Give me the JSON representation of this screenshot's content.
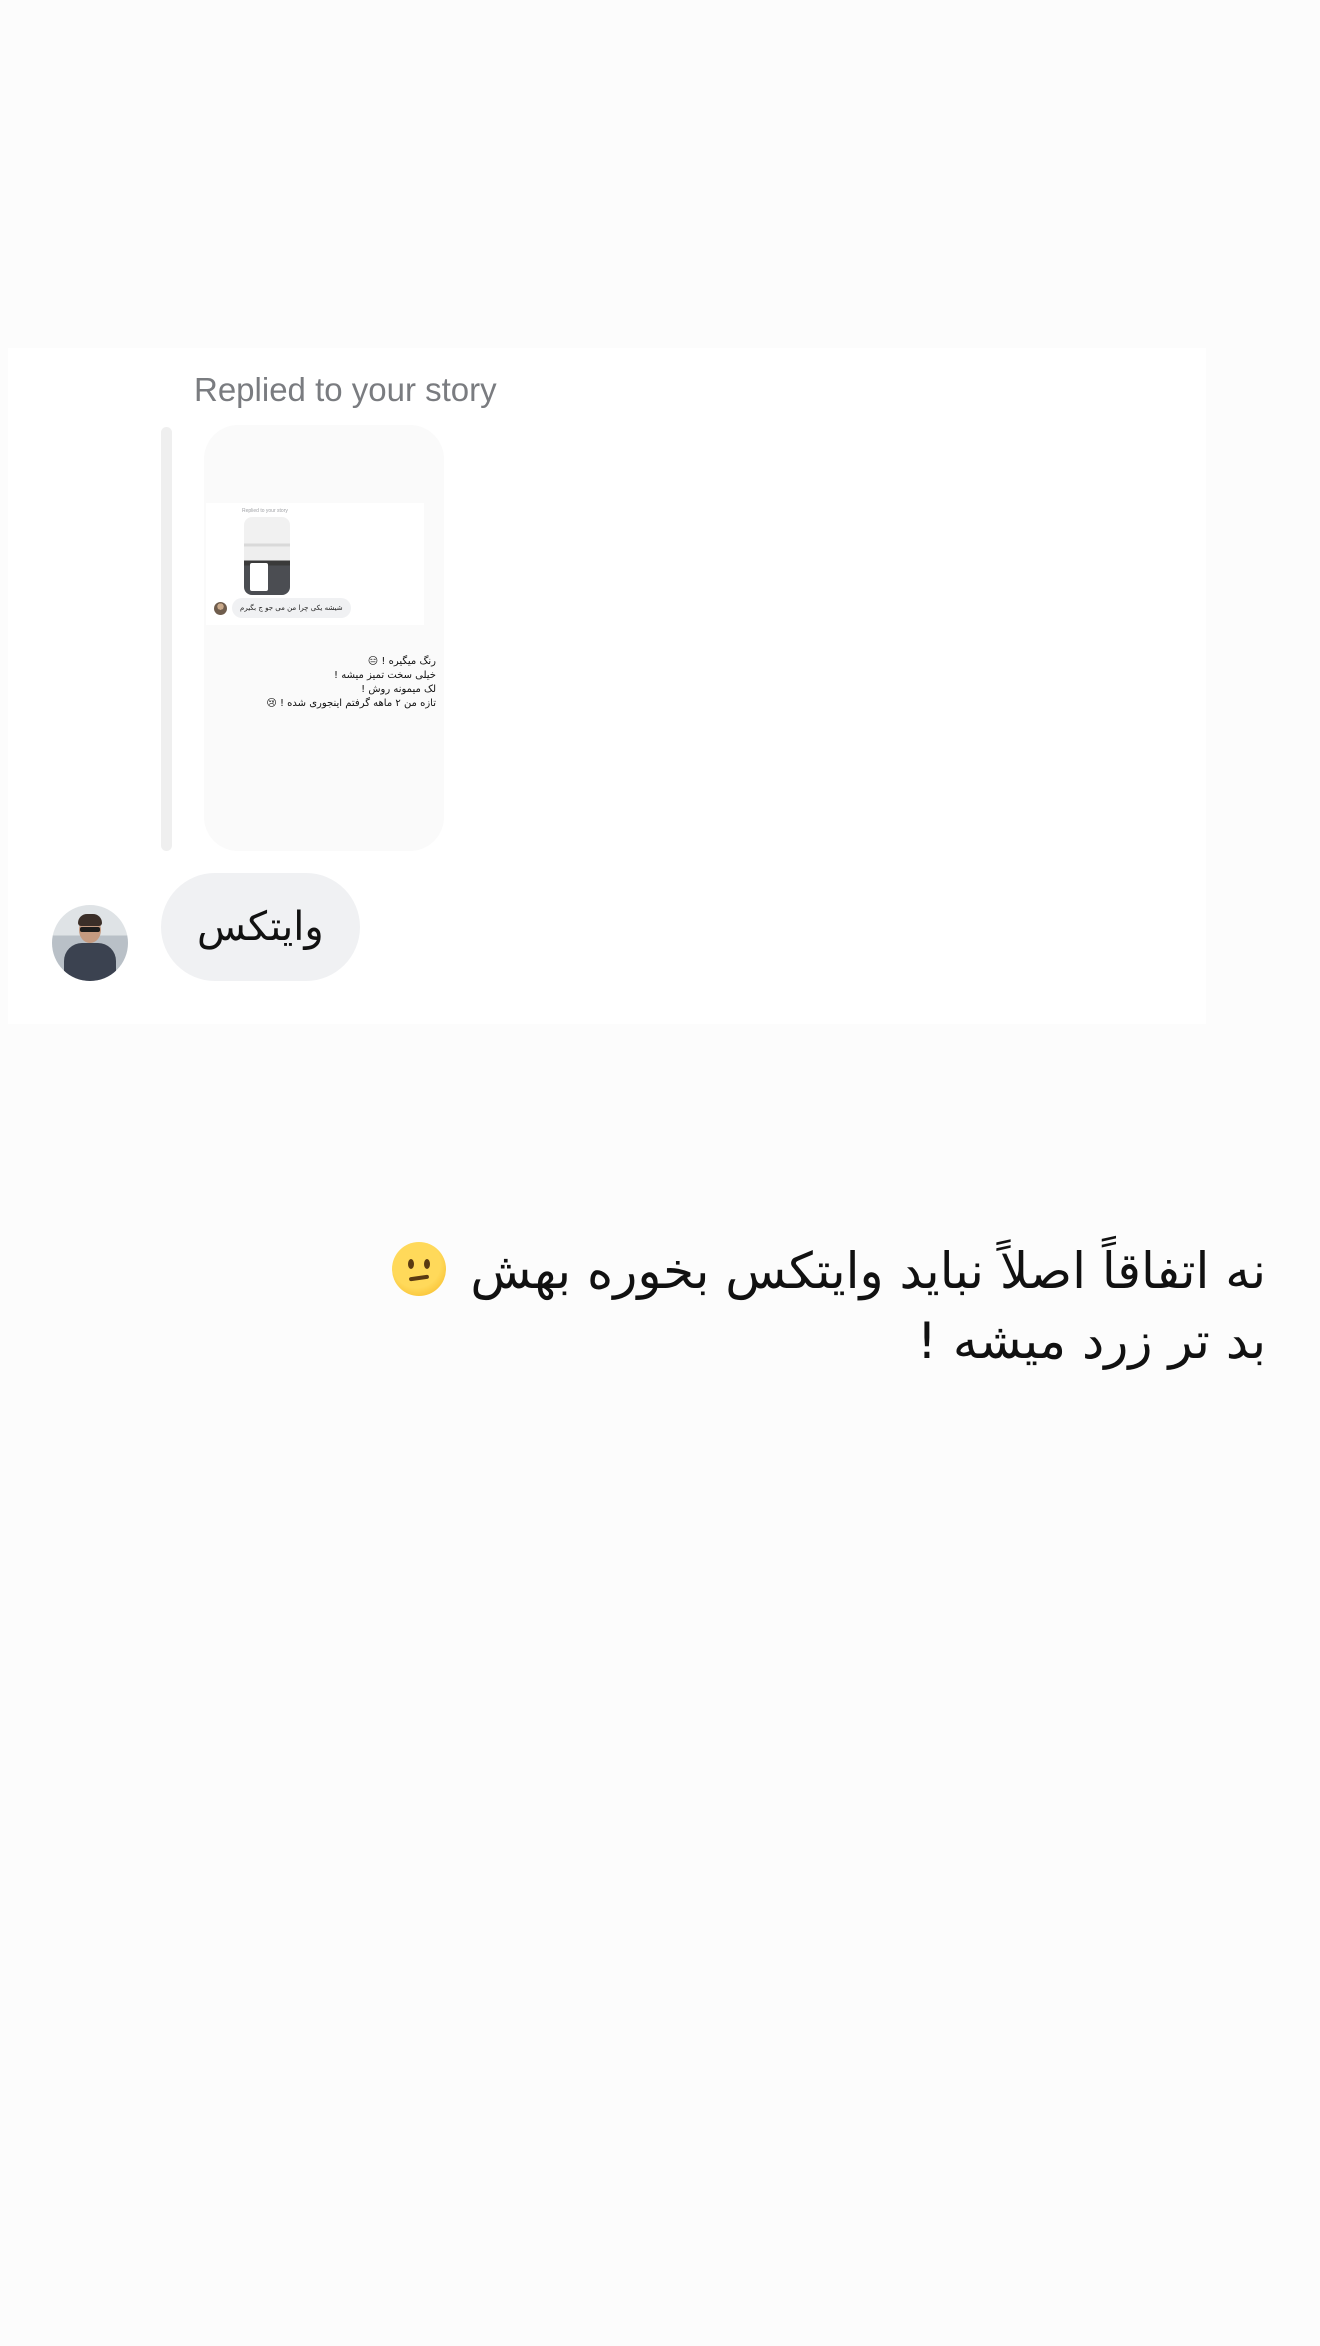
{
  "reply": {
    "header": "Replied to your story",
    "story_preview": {
      "inner_header": "Replied to your story",
      "inner_bubble": "شیشه یکی چرا من می جو ج بگیرم",
      "text_lines": "رنگ میگیره ! 😑\nخیلی سخت تمیز میشه !\nلک میمونه روش !\nتازه من ۲ ماهه گرفتم اینجوری شده ! 😢"
    }
  },
  "message": {
    "text": "وایتکس",
    "avatar": "sender-avatar"
  },
  "caption": {
    "line1": "نه اتفاقاً اصلاً نباید وایتکس بخوره بهش",
    "line2": "بد تر زرد میشه !",
    "emoji": "confused-face-icon"
  },
  "colors": {
    "background": "#fcfcfc",
    "panel": "#ffffff",
    "bubble": "#f0f1f3",
    "muted_text": "#7a7c80"
  }
}
